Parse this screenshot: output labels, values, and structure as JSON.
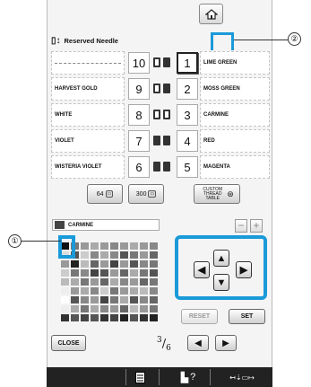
{
  "header": {
    "title": "Reserved Needle",
    "home_icon": "home-icon"
  },
  "rows": [
    {
      "left_label": "",
      "left_num": "10",
      "spools": [
        "outline",
        "filled"
      ],
      "right_num": "1",
      "right_label": "LIME GREEN"
    },
    {
      "left_label": "HARVEST GOLD",
      "left_num": "9",
      "spools": [
        "outline",
        "filled"
      ],
      "right_num": "2",
      "right_label": "MOSS GREEN"
    },
    {
      "left_label": "WHITE",
      "left_num": "8",
      "spools": [
        "outline",
        "outline"
      ],
      "right_num": "3",
      "right_label": "CARMINE"
    },
    {
      "left_label": "VIOLET",
      "left_num": "7",
      "spools": [
        "filled",
        "filled"
      ],
      "right_num": "4",
      "right_label": "RED"
    },
    {
      "left_label": "WISTERIA VIOLET",
      "left_num": "6",
      "spools": [
        "filled",
        "filled"
      ],
      "right_num": "5",
      "right_label": "MAGENTA"
    }
  ],
  "palette_buttons": {
    "b64": "64",
    "b300": "300",
    "custom": "CUSTOM THREAD TABLE"
  },
  "selected_color": {
    "name": "CARMINE",
    "swatch": "#444444"
  },
  "plus_minus": {
    "minus": "−",
    "plus": "+"
  },
  "palette_colors": [
    "#111111",
    "#777777",
    "#999999",
    "#aaaaaa",
    "#999999",
    "#888888",
    "#999999",
    "#aaaaaa",
    "#999999",
    "#888888",
    "#dddddd",
    "#555555",
    "#cccccc",
    "#888888",
    "#aaaaaa",
    "#888888",
    "#555555",
    "#777777",
    "#999999",
    "#666666",
    "#999999",
    "#222222",
    "#bbbbbb",
    "#666666",
    "#999999",
    "#444444",
    "#999999",
    "#555555",
    "#888888",
    "#777777",
    "#cccccc",
    "#777777",
    "#888888",
    "#444444",
    "#555555",
    "#999999",
    "#666666",
    "#aaaaaa",
    "#777777",
    "#555555",
    "#bbbbbb",
    "#aaaaaa",
    "#777777",
    "#999999",
    "#666666",
    "#aaaaaa",
    "#888888",
    "#999999",
    "#666666",
    "#777777",
    "#eeeeee",
    "#999999",
    "#aaaaaa",
    "#888888",
    "#cccccc",
    "#777777",
    "#999999",
    "#aaaaaa",
    "#bbbbbb",
    "#888888",
    "#ffffff",
    "#555555",
    "#888888",
    "#999999",
    "#444444",
    "#777777",
    "#aaaaaa",
    "#555555",
    "#888888",
    "#666666",
    "#eeeeee",
    "#aaaaaa",
    "#777777",
    "#aaaaaa",
    "#888888",
    "#999999",
    "#666666",
    "#bbbbbb",
    "#999999",
    "#777777",
    "#333333",
    "#555555",
    "#444444",
    "#555555",
    "#333333",
    "#444444",
    "#222222",
    "#555555",
    "#333333",
    "#222222"
  ],
  "arrows": {
    "up": "▲",
    "down": "▼",
    "left": "◀",
    "right": "▶"
  },
  "actions": {
    "reset": "RESET",
    "set": "SET",
    "close": "CLOSE"
  },
  "pagination": {
    "current": "3",
    "total": "6",
    "prev": "◀",
    "next": "▶"
  },
  "bottom_bar": {
    "sewing_icon": "needle-icon",
    "help": "?",
    "thread": "⇣"
  },
  "callouts": {
    "one": "①",
    "two": "②"
  },
  "colors": {
    "accent": "#1a9ad9"
  }
}
